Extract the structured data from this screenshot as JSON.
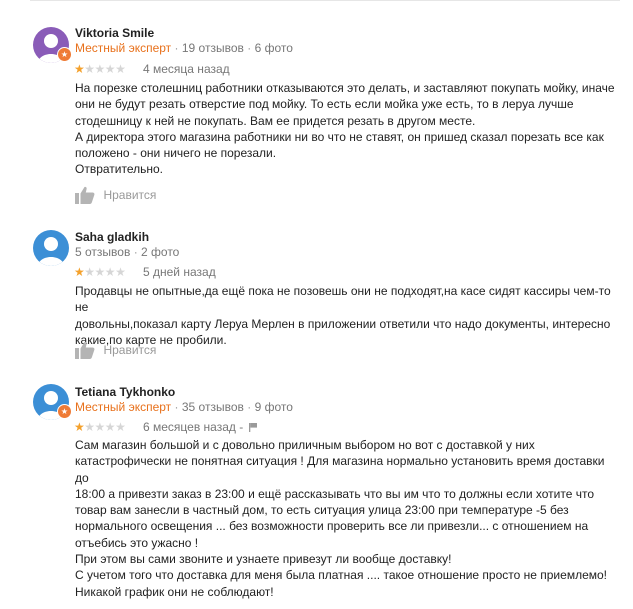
{
  "reviews": [
    {
      "author": "Viktoria Smile",
      "is_expert": true,
      "expert_label": "Местный эксперт",
      "reviews_count": "19 отзывов",
      "photos_count": "6 фото",
      "rating": 1,
      "max_rating": 5,
      "date": "4 месяца назад",
      "text": "На порезке столешниц работники отказываются это делать, и заставляют покупать мойку, иначе\nони не будут резать отверстие под мойку. То есть если  мойка уже есть, то в леруа лучше\nстодешницу к ней не покупать. Вам ее придется резать в другом месте.\nА директора этого магазина работники ни во что не ставят, он пришед сказал порезать все как\nположено - они ничего не порезали.\nОтвратительно.",
      "like_label": "Нравится",
      "avatar_color": "#8a5cb8"
    },
    {
      "author": "Saha gladkih",
      "is_expert": false,
      "reviews_count": "5 отзывов",
      "photos_count": "2 фото",
      "rating": 1,
      "max_rating": 5,
      "date": "5 дней назад",
      "text": "Продавцы не опытные,да ещё пока не позовешь они не подходят,на касе сидят кассиры чем-то не\nдовольны,показал карту Леруа Мерлен в приложении ответили что надо документы, интересно\nкакие,по карте не пробили.",
      "like_label": "Нравится",
      "avatar_color": "#3c8fd6"
    },
    {
      "author": "Tetiana Tykhonko",
      "is_expert": true,
      "expert_label": "Местный эксперт",
      "reviews_count": "35 отзывов",
      "photos_count": "9 фото",
      "rating": 1,
      "max_rating": 5,
      "date": "6 месяцев назад",
      "date_suffix": "-",
      "text": "Сам магазин большой и с довольно приличным выбором но вот с доставкой у них\nкатастрофически не понятная ситуация ! Для магазина нормально установить время доставки до\n18:00 а привезти заказ в 23:00 и ещё рассказывать что вы им что то должны если хотите что\nтовар вам занесли в частный дом, то есть ситуация улица 23:00 при температуре -5 без\nнормального освещения ... без возможности проверить все ли привезли... с отношением на\nотъебись это ужасно !\n При этом вы сами звоните и узнаете привезут ли вообще доставку!\n С учетом того что доставка для меня была платная .... такое отношение просто не приемлемо!\nНикакой график они не соблюдают!",
      "avatar_color": "#3c8fd6"
    }
  ],
  "icons": {
    "like": "thumbs-up-icon",
    "flag": "flag-icon",
    "expert": "star-badge-icon",
    "avatar": "person-icon"
  },
  "colors": {
    "expert_text": "#e8711c",
    "star_filled": "#f4a12c",
    "star_empty": "#d6d6d6",
    "muted": "#777777"
  }
}
